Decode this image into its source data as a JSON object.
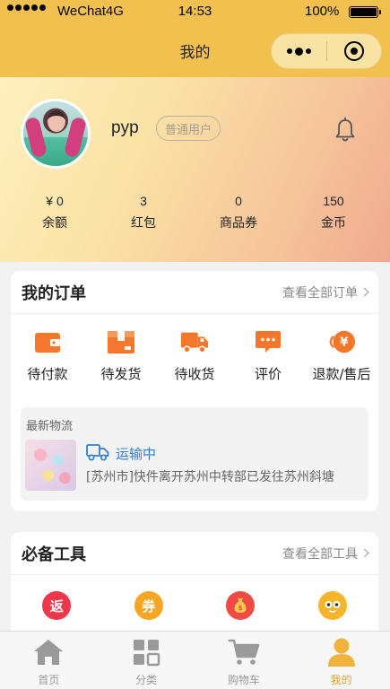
{
  "status_bar": {
    "carrier": "WeChat4G",
    "time": "14:53",
    "battery": "100%"
  },
  "navbar": {
    "title": "我的"
  },
  "profile": {
    "username": "pyp",
    "badge": "普通用户",
    "stats": [
      {
        "value": "¥ 0",
        "label": "余额"
      },
      {
        "value": "3",
        "label": "红包"
      },
      {
        "value": "0",
        "label": "商品券"
      },
      {
        "value": "150",
        "label": "金币"
      }
    ]
  },
  "orders": {
    "title": "我的订单",
    "more": "查看全部订单",
    "items": [
      {
        "label": "待付款",
        "icon": "wallet-icon"
      },
      {
        "label": "待发货",
        "icon": "box-icon"
      },
      {
        "label": "待收货",
        "icon": "truck-icon"
      },
      {
        "label": "评价",
        "icon": "comment-icon"
      },
      {
        "label": "退款/售后",
        "icon": "refund-icon"
      }
    ],
    "logistics": {
      "title": "最新物流",
      "status": "运输中",
      "description": "[苏州市]快件离开苏州中转部已发往苏州斜塘"
    }
  },
  "tools": {
    "title": "必备工具",
    "more": "查看全部工具",
    "items": [
      {
        "glyph": "返",
        "icon": "rebate-icon",
        "color": "#f0364a"
      },
      {
        "glyph": "券",
        "icon": "coupon-icon",
        "color": "#f6a623"
      },
      {
        "glyph": "",
        "icon": "moneybag-icon",
        "color": "#f04a44"
      },
      {
        "glyph": "",
        "icon": "mascot-icon",
        "color": "#f6b52a"
      }
    ]
  },
  "tabbar": {
    "items": [
      {
        "label": "首页",
        "icon": "home-icon"
      },
      {
        "label": "分类",
        "icon": "category-icon"
      },
      {
        "label": "购物车",
        "icon": "cart-icon"
      },
      {
        "label": "我的",
        "icon": "user-icon",
        "active": true
      }
    ]
  },
  "colors": {
    "accent": "#f2c04f",
    "orange": "#f5772c",
    "link": "#2f7fd6"
  }
}
